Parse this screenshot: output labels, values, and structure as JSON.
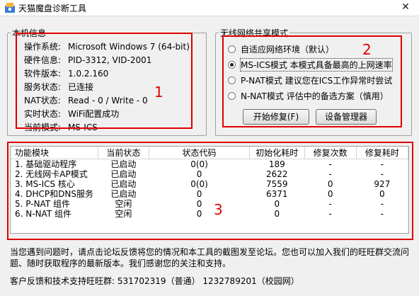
{
  "window": {
    "title": "天猫魔盘诊断工具",
    "close_glyph": "✕"
  },
  "info": {
    "legend": "本机信息",
    "rows": [
      {
        "key": "操作系统:",
        "value": "Microsoft Windows 7 (64-bit)"
      },
      {
        "key": "硬件信息:",
        "value": "PID-3312, VID-2001"
      },
      {
        "key": "软件版本:",
        "value": "1.0.2.160"
      },
      {
        "key": "服务状态:",
        "value": "已连接"
      },
      {
        "key": "NAT状态:",
        "value": "Read - 0 / Write - 0"
      },
      {
        "key": "实时状态:",
        "value": "WiFi配置成功"
      },
      {
        "key": "当前模式:",
        "value": "MS-ICS"
      }
    ]
  },
  "share": {
    "legend": "无线网络共享模式",
    "options": [
      {
        "label": "自适应网络环境（默认）",
        "checked": false
      },
      {
        "label": "MS-ICS模式 本模式具备最高的上网速率",
        "checked": true
      },
      {
        "label": "P-NAT模式 建议您在ICS工作异常时尝试",
        "checked": false
      },
      {
        "label": "N-NAT模式 评估中的备选方案（慎用）",
        "checked": false
      }
    ],
    "repair_button": "开始修复(F)",
    "devmgr_button": "设备管理器"
  },
  "status_table": {
    "headers": [
      "功能模块",
      "当前状态",
      "状态代码",
      "初始化耗时",
      "修复次数",
      "修复耗时"
    ],
    "rows": [
      [
        "1. 基础驱动程序",
        "已启动",
        "0(0)",
        "189",
        "-",
        "-"
      ],
      [
        "2. 无线网卡AP模式",
        "已启动",
        "0",
        "2622",
        "-",
        "-"
      ],
      [
        "3. MS-ICS 核心",
        "已启动",
        "0(0)",
        "7559",
        "0",
        "927"
      ],
      [
        "4. DHCP和DNS服务",
        "已启动",
        "0",
        "6371",
        "0",
        "0"
      ],
      [
        "5. P-NAT 组件",
        "空闲",
        "0",
        "0",
        "-",
        "-"
      ],
      [
        "6. N-NAT 组件",
        "空闲",
        "0",
        "0",
        "-",
        "-"
      ]
    ]
  },
  "annotations": {
    "marker1": "1",
    "marker2": "2",
    "marker3": "3"
  },
  "footer": {
    "notice": "当您遇到问题时，请点击论坛反馈将您的情况和本工具的截图发至论坛。您也可以加入我们的旺旺群交流问题、随时获取程序的最新版本。我们感谢您的关注和支持。",
    "contact": "客户反馈和技术支持旺旺群:  531702319（普通）  1232789201（校园网）"
  },
  "colors": {
    "annotation_red": "#e00000",
    "window_bg": "#f0f0f0"
  }
}
